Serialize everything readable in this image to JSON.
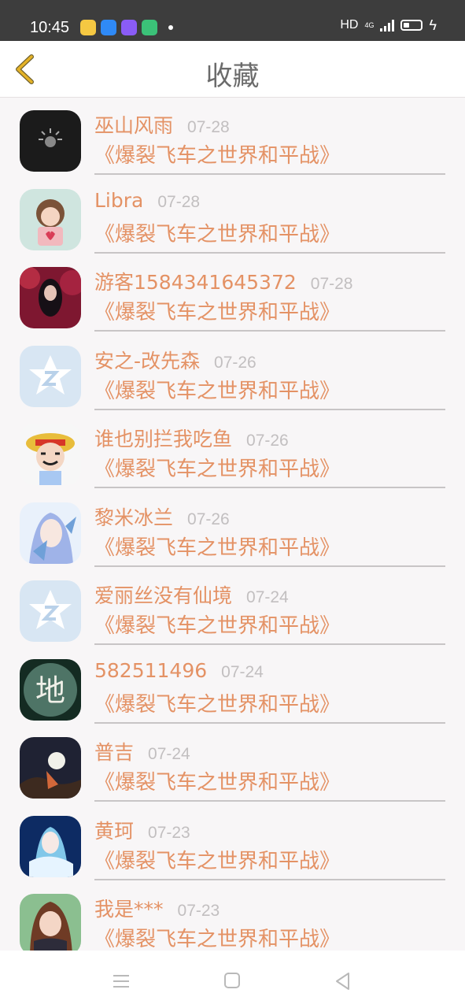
{
  "status_bar": {
    "time": "10:45",
    "hd": "HD",
    "network": "4G",
    "colors": {
      "app1": "#f5c842",
      "app2": "#2f8af6",
      "app3": "#8a5cf6",
      "app4": "#3bc178"
    }
  },
  "header": {
    "title": "收藏",
    "back_icon": "chevron-left-icon",
    "accent": "#e4b227"
  },
  "favorites": [
    {
      "name": "巫山风雨",
      "date": "07-28",
      "title": "《爆裂飞车之世界和平战》",
      "avatar": "black-emblem"
    },
    {
      "name": "Libra",
      "date": "07-28",
      "title": "《爆裂飞车之世界和平战》",
      "avatar": "girl-heart"
    },
    {
      "name": "游客1584341645372",
      "date": "07-28",
      "title": "《爆裂飞车之世界和平战》",
      "avatar": "woman-red"
    },
    {
      "name": "安之-改先森",
      "date": "07-26",
      "title": "《爆裂飞车之世界和平战》",
      "avatar": "qq-star"
    },
    {
      "name": "谁也别拦我吃鱼",
      "date": "07-26",
      "title": "《爆裂飞车之世界和平战》",
      "avatar": "straw-hat"
    },
    {
      "name": "黎米冰兰",
      "date": "07-26",
      "title": "《爆裂飞车之世界和平战》",
      "avatar": "blue-hair-girl"
    },
    {
      "name": "爱丽丝没有仙境",
      "date": "07-24",
      "title": "《爆裂飞车之世界和平战》",
      "avatar": "qq-star"
    },
    {
      "name": "582511496",
      "date": "07-24",
      "title": "《爆裂飞车之世界和平战》",
      "avatar": "character-di",
      "avatar_text": "地"
    },
    {
      "name": "普吉",
      "date": "07-24",
      "title": "《爆裂飞车之世界和平战》",
      "avatar": "moon-night"
    },
    {
      "name": "黄珂",
      "date": "07-23",
      "title": "《爆裂飞车之世界和平战》",
      "avatar": "anime-blue"
    },
    {
      "name": "我是***",
      "date": "07-23",
      "title": "《爆裂飞车之世界和平战》",
      "avatar": "anime-brown"
    }
  ],
  "bottom_nav": {
    "menu_icon": "menu-icon",
    "home_icon": "home-square-icon",
    "back_icon": "back-triangle-icon"
  }
}
